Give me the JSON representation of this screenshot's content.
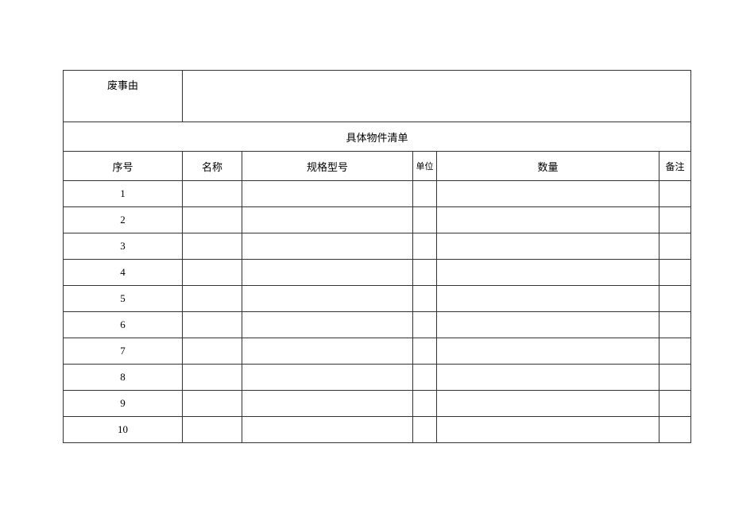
{
  "form": {
    "reason_label": "废事由",
    "reason_value": "",
    "list_title": "具体物件清单",
    "columns": {
      "seq": "序号",
      "name": "名称",
      "spec": "规格型号",
      "unit": "单位",
      "qty": "数量",
      "note": "备注"
    },
    "rows": [
      {
        "seq": "1",
        "name": "",
        "spec": "",
        "unit": "",
        "qty": "",
        "note": ""
      },
      {
        "seq": "2",
        "name": "",
        "spec": "",
        "unit": "",
        "qty": "",
        "note": ""
      },
      {
        "seq": "3",
        "name": "",
        "spec": "",
        "unit": "",
        "qty": "",
        "note": ""
      },
      {
        "seq": "4",
        "name": "",
        "spec": "",
        "unit": "",
        "qty": "",
        "note": ""
      },
      {
        "seq": "5",
        "name": "",
        "spec": "",
        "unit": "",
        "qty": "",
        "note": ""
      },
      {
        "seq": "6",
        "name": "",
        "spec": "",
        "unit": "",
        "qty": "",
        "note": ""
      },
      {
        "seq": "7",
        "name": "",
        "spec": "",
        "unit": "",
        "qty": "",
        "note": ""
      },
      {
        "seq": "8",
        "name": "",
        "spec": "",
        "unit": "",
        "qty": "",
        "note": ""
      },
      {
        "seq": "9",
        "name": "",
        "spec": "",
        "unit": "",
        "qty": "",
        "note": ""
      },
      {
        "seq": "10",
        "name": "",
        "spec": "",
        "unit": "",
        "qty": "",
        "note": ""
      }
    ]
  }
}
